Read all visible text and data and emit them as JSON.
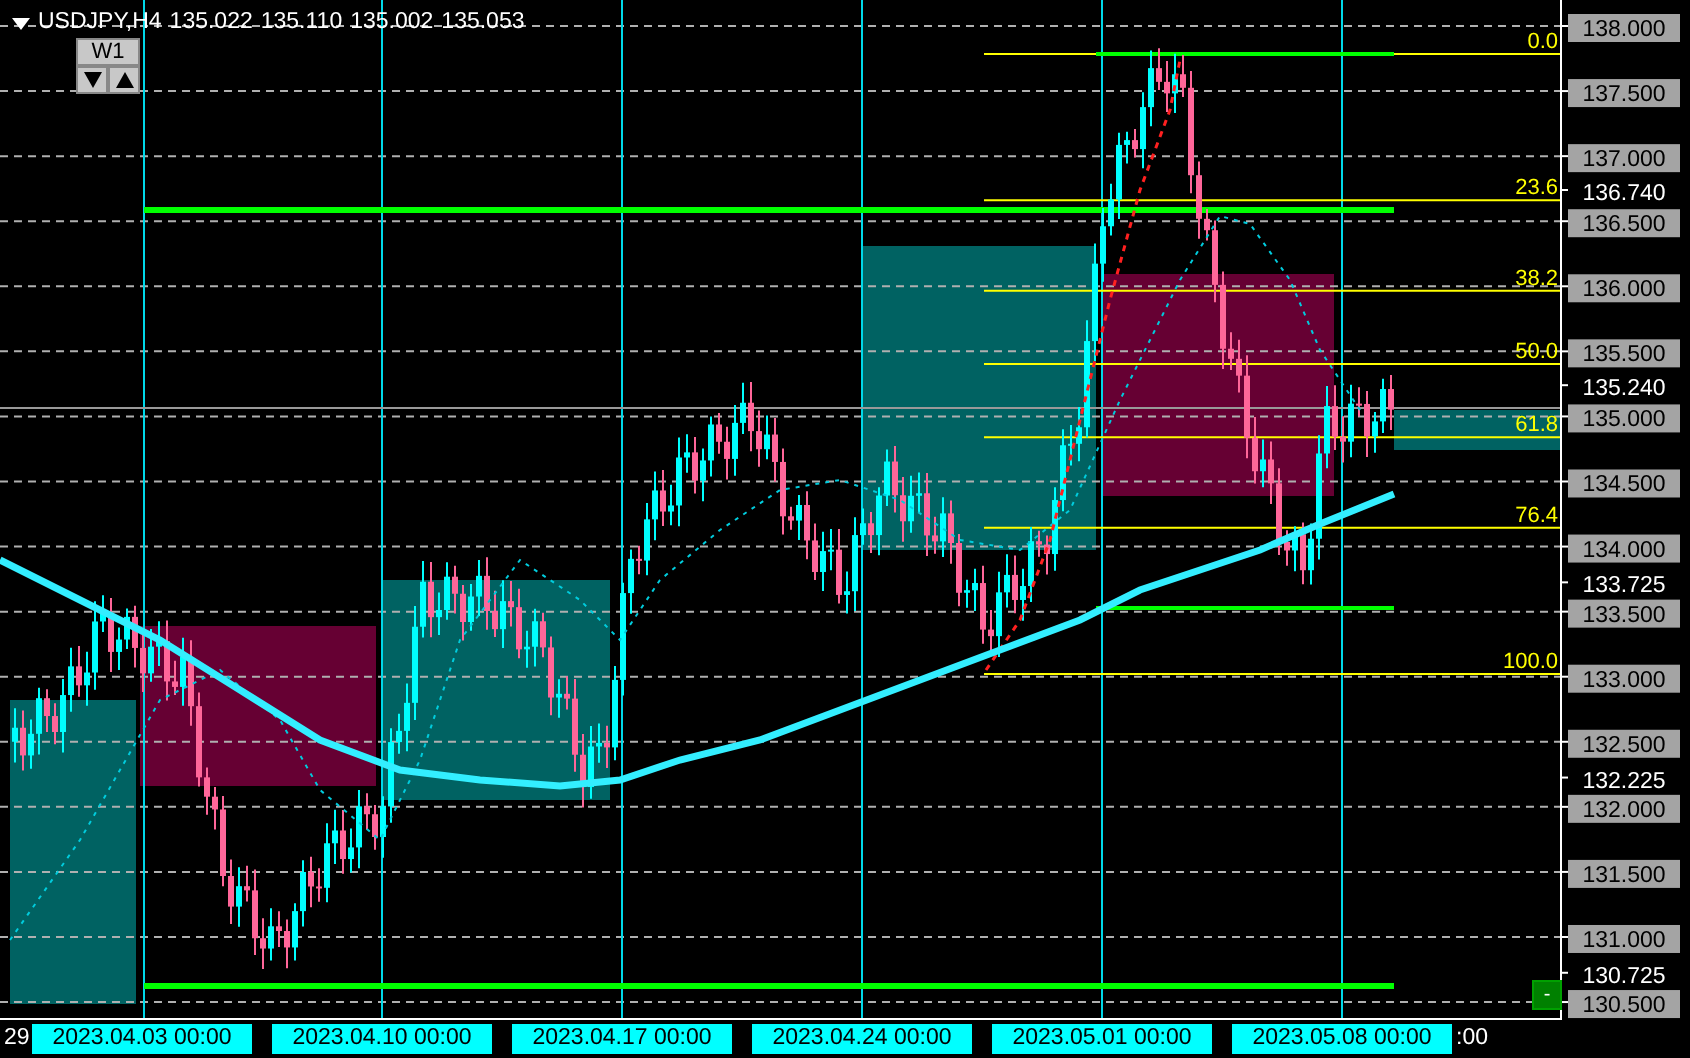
{
  "header": {
    "symbol": "USDJPY,H4",
    "prices": [
      "135.022",
      "135.110",
      "135.002",
      "135.053"
    ]
  },
  "timeframe_button": {
    "label": "W1"
  },
  "zones": [
    {
      "color": "#006262"
    },
    {
      "color": "#660033"
    },
    {
      "color": "#006262"
    },
    {
      "color": "#006262"
    },
    {
      "color": "#660033"
    },
    {
      "color": "#006262"
    }
  ],
  "fibonacci_levels": [
    "0.0",
    "23.6",
    "38.2",
    "50.0",
    "61.8",
    "76.4",
    "100.0"
  ],
  "collapse_button": {
    "label": "-"
  },
  "price_axis": [
    {
      "label": "138.000",
      "kind": "grid"
    },
    {
      "label": "137.500",
      "kind": "grid"
    },
    {
      "label": "137.000",
      "kind": "grid"
    },
    {
      "label": "136.740",
      "kind": "marker"
    },
    {
      "label": "136.500",
      "kind": "grid"
    },
    {
      "label": "136.000",
      "kind": "grid"
    },
    {
      "label": "135.500",
      "kind": "grid"
    },
    {
      "label": "135.240",
      "kind": "marker"
    },
    {
      "label": "135.000",
      "kind": "grid"
    },
    {
      "label": "134.500",
      "kind": "grid"
    },
    {
      "label": "134.000",
      "kind": "grid"
    },
    {
      "label": "133.725",
      "kind": "marker"
    },
    {
      "label": "133.500",
      "kind": "grid"
    },
    {
      "label": "133.000",
      "kind": "grid"
    },
    {
      "label": "132.500",
      "kind": "grid"
    },
    {
      "label": "132.225",
      "kind": "marker"
    },
    {
      "label": "132.000",
      "kind": "grid"
    },
    {
      "label": "131.500",
      "kind": "grid"
    },
    {
      "label": "131.000",
      "kind": "grid"
    },
    {
      "label": "130.725",
      "kind": "marker"
    },
    {
      "label": "130.500",
      "kind": "grid"
    }
  ],
  "date_axis": [
    {
      "label": "29",
      "kind": "plain"
    },
    {
      "label": "2023.04.03 00:00",
      "kind": "highlight"
    },
    {
      "label": "2023.04.10 00:00",
      "kind": "highlight"
    },
    {
      "label": "2023.04.17 00:00",
      "kind": "highlight"
    },
    {
      "label": "2023.04.24 00:00",
      "kind": "highlight"
    },
    {
      "label": "2023.05.01 00:00",
      "kind": "highlight"
    },
    {
      "label": "2023.05.08 00:00",
      "kind": "highlight"
    },
    {
      "label": ":00",
      "kind": "plain"
    }
  ]
}
